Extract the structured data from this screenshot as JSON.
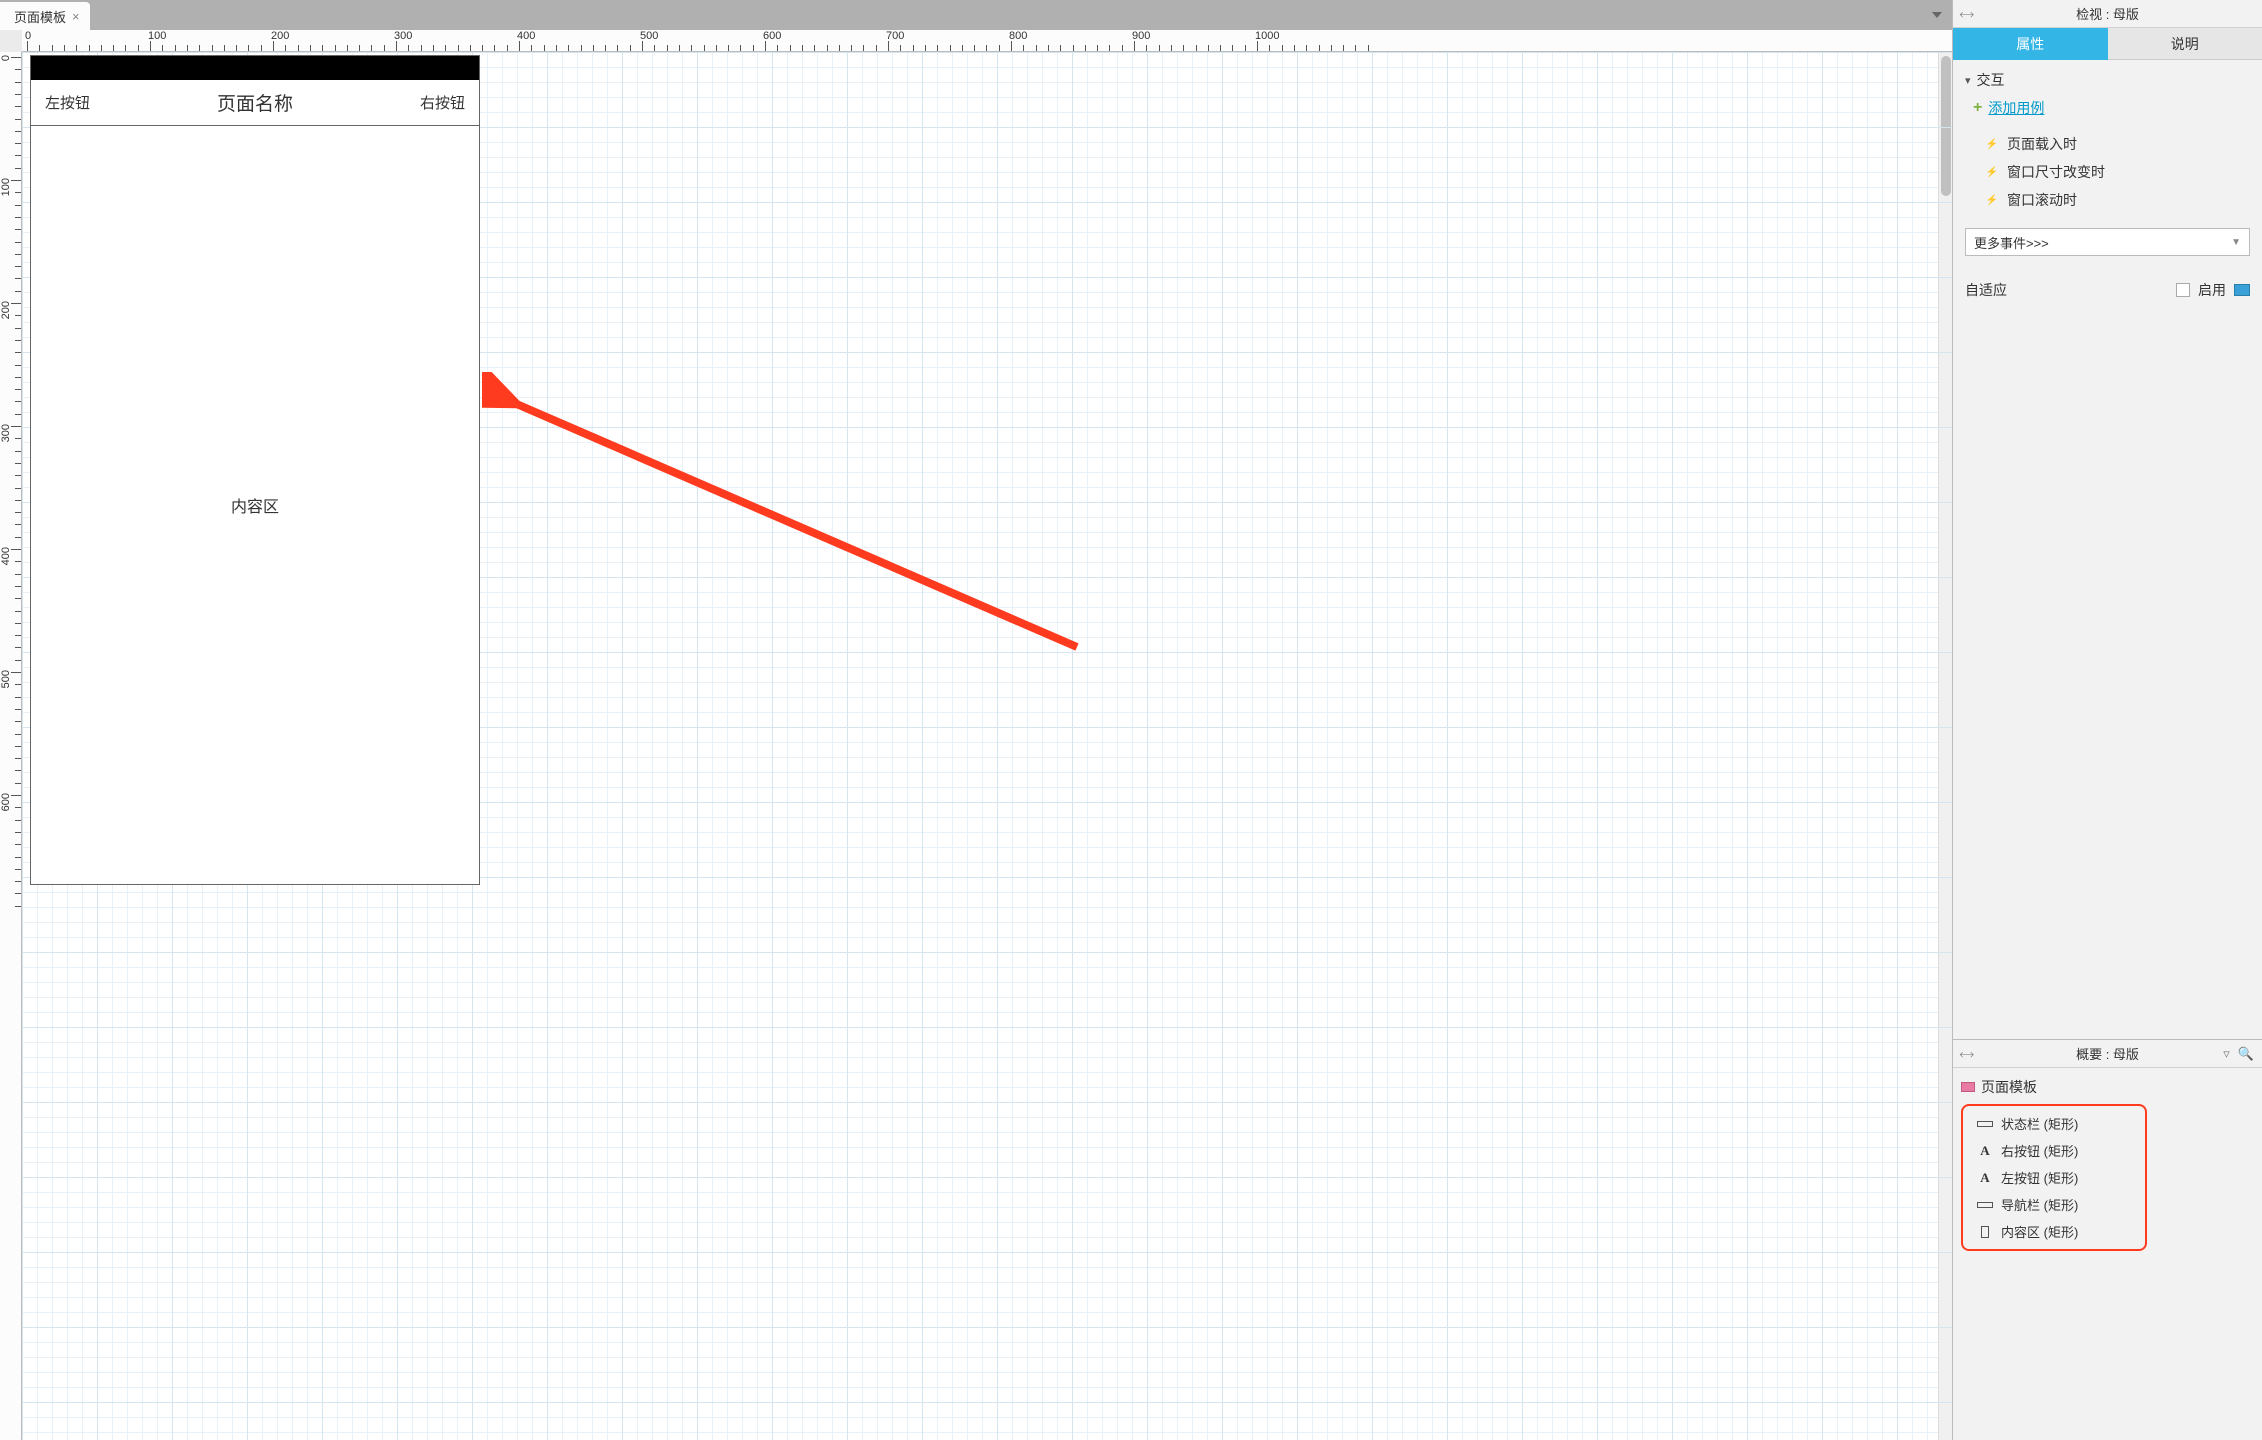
{
  "tabs": {
    "page_template": "页面模板"
  },
  "ruler": {
    "h_marks": [
      0,
      100,
      200,
      300,
      400,
      500,
      600,
      700,
      800,
      900,
      1000
    ],
    "v_marks": [
      0,
      100,
      200,
      300,
      400,
      500,
      600
    ]
  },
  "mockup": {
    "left_button": "左按钮",
    "title": "页面名称",
    "right_button": "右按钮",
    "content_label": "内容区"
  },
  "inspector": {
    "title": "检视 : 母版",
    "tabs": {
      "properties": "属性",
      "notes": "说明"
    },
    "sections": {
      "interactions": "交互",
      "add_case": "添加用例",
      "events": {
        "on_page_load": "页面载入时",
        "on_window_resize": "窗口尺寸改变时",
        "on_window_scroll": "窗口滚动时"
      },
      "more_events": "更多事件>>>",
      "adaptive": {
        "label": "自适应",
        "enable": "启用"
      }
    }
  },
  "outline": {
    "title": "概要 : 母版",
    "root": "页面模板",
    "items": {
      "status_bar": "状态栏 (矩形)",
      "right_button": "右按钮 (矩形)",
      "left_button": "左按钮 (矩形)",
      "nav_bar": "导航栏 (矩形)",
      "content_area": "内容区 (矩形)"
    }
  }
}
